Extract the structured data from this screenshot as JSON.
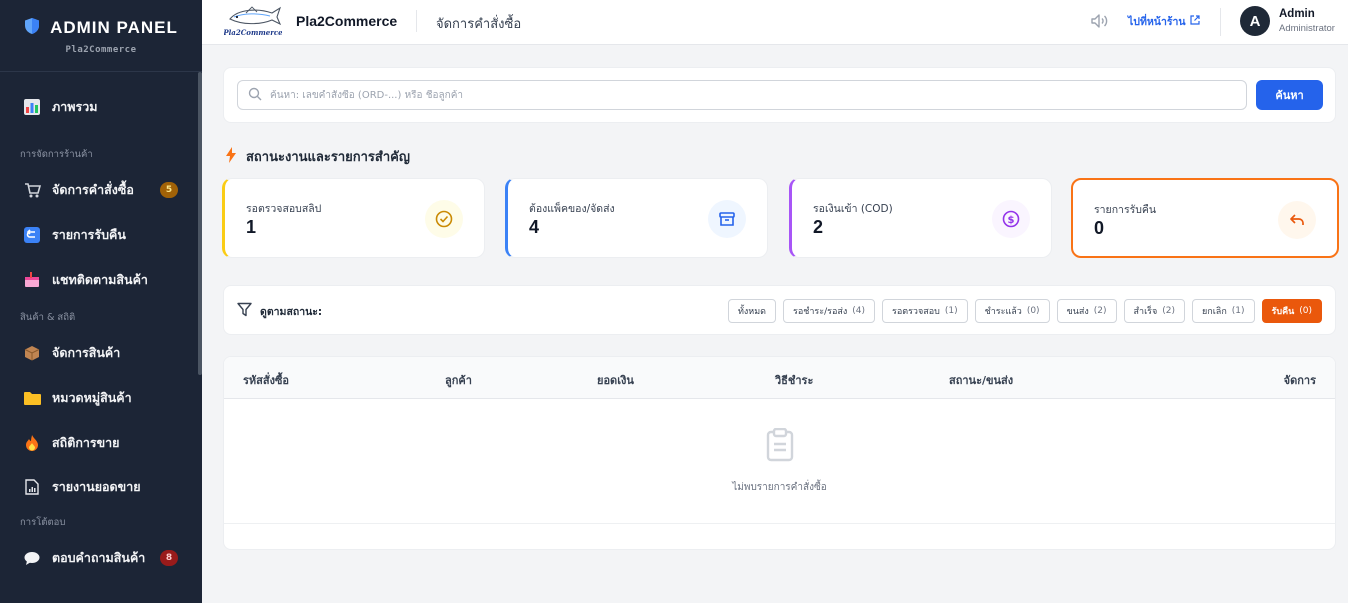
{
  "sidebar": {
    "title": "ADMIN PANEL",
    "subtitle": "Pla2Commerce",
    "items": [
      {
        "label": "ภาพรวม"
      },
      {
        "label": "จัดการคำสั่งซื้อ",
        "badge": "5"
      },
      {
        "label": "รายการรับคืน"
      },
      {
        "label": "แชทติดตามสินค้า"
      },
      {
        "label": "จัดการสินค้า"
      },
      {
        "label": "หมวดหมู่สินค้า"
      },
      {
        "label": "สถิติการขาย"
      },
      {
        "label": "รายงานยอดขาย"
      },
      {
        "label": "ตอบคำถามสินค้า",
        "badge": "8"
      }
    ],
    "sections": [
      "การจัดการร้านค้า",
      "สินค้า & สถิติ",
      "การโต้ตอบ"
    ]
  },
  "header": {
    "logo_text": "Pla2Commerce",
    "store_name": "Pla2Commerce",
    "page_title": "จัดการคำสั่งซื้อ",
    "store_link": "ไปที่หน้าร้าน",
    "user_initial": "A",
    "user_name": "Admin",
    "user_role": "Administrator"
  },
  "search": {
    "placeholder": "ค้นหา: เลขคำสั่งซื้อ (ORD-...) หรือ ชื่อลูกค้า",
    "value": "",
    "button": "ค้นหา"
  },
  "status_section": {
    "title": "สถานะงานและรายการสำคัญ",
    "cards": [
      {
        "label": "รอตรวจสอบสลิป",
        "value": "1",
        "icon": "check-circle-icon",
        "color": "#facc15"
      },
      {
        "label": "ต้องแพ็คของ/จัดส่ง",
        "value": "4",
        "icon": "archive-box-icon",
        "color": "#3b82f6"
      },
      {
        "label": "รอเงินเข้า (COD)",
        "value": "2",
        "icon": "dollar-circle-icon",
        "color": "#a855f7"
      },
      {
        "label": "รายการรับคืน",
        "value": "0",
        "icon": "undo-arrow-icon",
        "color": "#f97316"
      }
    ]
  },
  "filter": {
    "label": "ดูตามสถานะ:",
    "chips": [
      {
        "label": "ทั้งหมด",
        "count": ""
      },
      {
        "label": "รอชำระ/รอส่ง",
        "count": "(4)"
      },
      {
        "label": "รอตรวจสอบ",
        "count": "(1)"
      },
      {
        "label": "ชำระแล้ว",
        "count": "(0)"
      },
      {
        "label": "ขนส่ง",
        "count": "(2)"
      },
      {
        "label": "สำเร็จ",
        "count": "(2)"
      },
      {
        "label": "ยกเลิก",
        "count": "(1)"
      },
      {
        "label": "รับคืน",
        "count": "(0)"
      }
    ],
    "active": "รับคืน"
  },
  "table": {
    "columns": [
      "รหัสสั่งซื้อ",
      "ลูกค้า",
      "ยอดเงิน",
      "วิธีชำระ",
      "สถานะ/ขนส่ง",
      "จัดการ"
    ],
    "empty_text": "ไม่พบรายการคำสั่งซื้อ"
  },
  "colors": {
    "sidebar_bg": "#1c2536",
    "accent_blue": "#2563eb",
    "accent_orange": "#ea580c"
  }
}
